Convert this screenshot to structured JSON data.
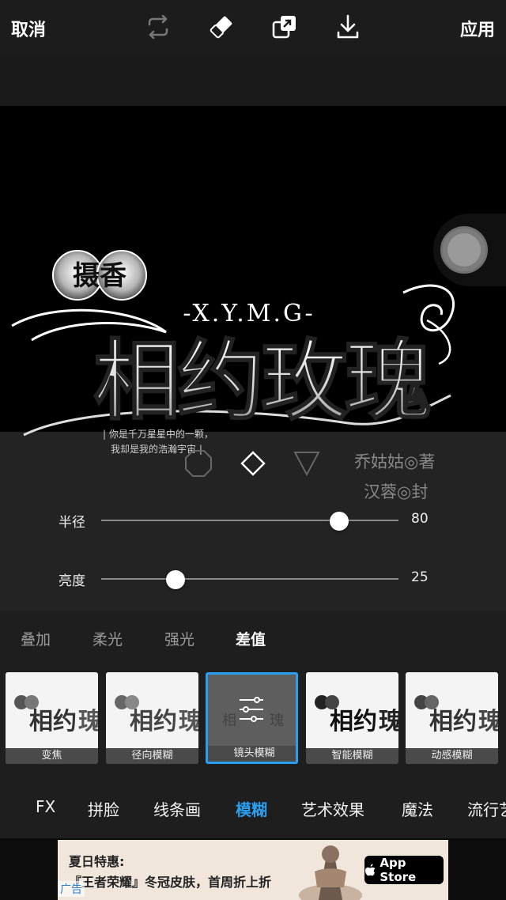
{
  "topbar": {
    "cancel_label": "取消",
    "apply_label": "应用",
    "tools": [
      "swap-icon",
      "eraser-icon",
      "layer-copy-icon",
      "download-icon"
    ]
  },
  "artwork": {
    "title_main": "相约玫瑰",
    "badge_text": "摄香",
    "subtitle": "-X.Y.M.G-",
    "tagline_1": "| 你是千万星星中的一颗，",
    "tagline_2": "我却是我的浩瀚宇宙 |",
    "credit_author": "乔姑姑◎著",
    "credit_cover": "汉蓉◎封"
  },
  "shape_selector": [
    "octagon-icon",
    "diamond-icon",
    "triangle-down-icon"
  ],
  "sliders": [
    {
      "label": "半径",
      "value": "80",
      "level": 0.8
    },
    {
      "label": "亮度",
      "value": "25",
      "level": 0.25
    }
  ],
  "blend_modes": [
    {
      "label": "叠加",
      "active": false
    },
    {
      "label": "柔光",
      "active": false
    },
    {
      "label": "强光",
      "active": false
    },
    {
      "label": "差值",
      "active": true
    }
  ],
  "effects": [
    {
      "label": "变焦",
      "selected": false
    },
    {
      "label": "径向模糊",
      "selected": false
    },
    {
      "label": "镜头模糊",
      "selected": true
    },
    {
      "label": "智能模糊",
      "selected": false
    },
    {
      "label": "动感模糊",
      "selected": false
    }
  ],
  "categories": [
    {
      "label": "FX",
      "active": false
    },
    {
      "label": "拼脸",
      "active": false
    },
    {
      "label": "线条画",
      "active": false
    },
    {
      "label": "模糊",
      "active": true
    },
    {
      "label": "艺术效果",
      "active": false
    },
    {
      "label": "魔法",
      "active": false
    },
    {
      "label": "流行艺",
      "active": false
    }
  ],
  "ad": {
    "line1": "夏日特惠:",
    "line2": "『王者荣耀』冬冠皮肤，首周折上折",
    "tag": "广告",
    "store_label": "App Store"
  },
  "colors": {
    "accent": "#2a9ff0",
    "panel": "#1e1e1e",
    "canvas": "#000000"
  }
}
